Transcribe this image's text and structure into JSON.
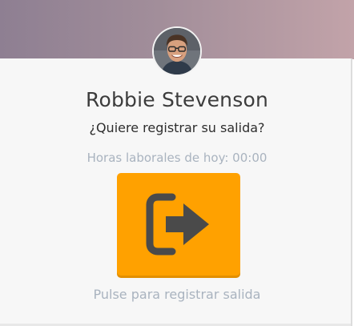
{
  "user": {
    "name": "Robbie Stevenson",
    "avatar_alt": "Robbie Stevenson"
  },
  "prompt": {
    "question": "¿Quiere registrar su salida?"
  },
  "work": {
    "hours_label": "Horas laborales de hoy: 00:00"
  },
  "action": {
    "icon": "sign-out-icon",
    "button_color": "#FFA100",
    "hint": "Pulse para registrar salida"
  },
  "colors": {
    "header_gradient_start": "#8E7F92",
    "header_gradient_end": "#C2A3A9",
    "card_background": "#F7F7F7",
    "muted_text": "#A9B3BF",
    "icon_color": "#4A4A4A"
  }
}
